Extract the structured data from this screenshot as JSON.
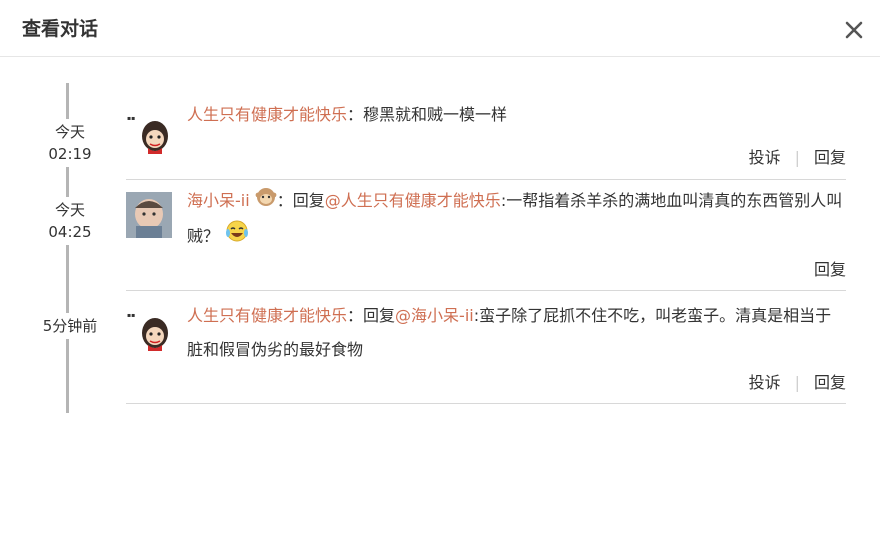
{
  "dialog": {
    "title": "查看对话"
  },
  "messages": [
    {
      "time_line1": "今天",
      "time_line2": "02:19",
      "author": "人生只有健康才能快乐",
      "sep": "：",
      "reply_prefix": "",
      "mention": "",
      "content_after": "穆黑就和贼一模一样",
      "actions": {
        "report": "投诉",
        "reply": "回复"
      }
    },
    {
      "time_line1": "今天",
      "time_line2": "04:25",
      "author": "海小呆-ii",
      "sep": "：",
      "reply_prefix": "回复",
      "mention": "@人生只有健康才能快乐",
      "content_after": ":一帮指着杀羊杀的满地血叫清真的东西管别人叫贼？",
      "actions": {
        "reply": "回复"
      }
    },
    {
      "time_line1": "5分钟前",
      "time_line2": "",
      "author": "人生只有健康才能快乐",
      "sep": "：",
      "reply_prefix": "回复",
      "mention": "@海小呆-ii",
      "content_after": ":蛮子除了屁抓不住不吃，叫老蛮子。清真是相当于脏和假冒伪劣的最好食物",
      "actions": {
        "report": "投诉",
        "reply": "回复"
      }
    }
  ],
  "colors": {
    "accent": "#cf6f52",
    "text": "#333333",
    "divider": "#d8d8d8",
    "timeline": "#b5b5b5"
  },
  "icons": {
    "close": "close-icon",
    "badge": "monkey-badge-icon",
    "emoji": "laughing-tears-emoji"
  }
}
